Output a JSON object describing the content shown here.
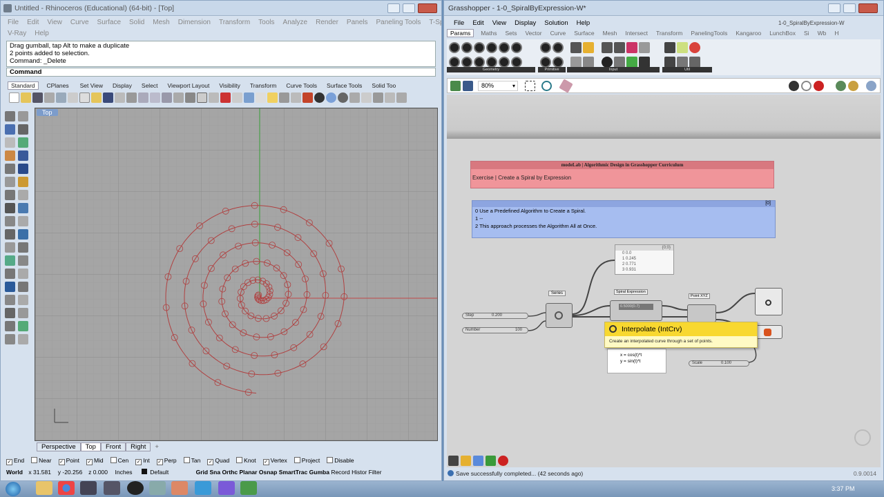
{
  "rhino": {
    "title": "Untitled - Rhinoceros (Educational) (64-bit) - [Top]",
    "menu": [
      "File",
      "Edit",
      "View",
      "Curve",
      "Surface",
      "Solid",
      "Mesh",
      "Dimension",
      "Transform",
      "Tools",
      "Analyze",
      "Render",
      "Panels",
      "Paneling Tools",
      "T-Splines"
    ],
    "menu2": [
      "V-Ray",
      "Help"
    ],
    "command_lines": [
      "Drag gumball, tap Alt to make a duplicate",
      "2 points added to selection.",
      "Command: _Delete"
    ],
    "command_label": "Command",
    "tabs": [
      "Standard",
      "CPlanes",
      "Set View",
      "Display",
      "Select",
      "Viewport Layout",
      "Visibility",
      "Transform",
      "Curve Tools",
      "Surface Tools",
      "Solid Too"
    ],
    "viewport_label": "Top",
    "view_tabs": [
      "Perspective",
      "Top",
      "Front",
      "Right"
    ],
    "add_tab": "+",
    "osnaps": [
      "End",
      "Near",
      "Point",
      "Mid",
      "Cen",
      "Int",
      "Perp",
      "Tan",
      "Quad",
      "Knot",
      "Vertex",
      "Project",
      "Disable"
    ],
    "osnap_checked": [
      true,
      false,
      true,
      true,
      false,
      true,
      true,
      false,
      true,
      false,
      true,
      false,
      false
    ],
    "status": {
      "world": "World",
      "x": "x 31.581",
      "y": "y -20.256",
      "z": "z 0.000",
      "units": "Inches",
      "layer": "Default"
    },
    "status_buttons": [
      "Grid Sna",
      "Orthc",
      "Planar",
      "Osnap",
      "SmartTrac",
      "Gumba",
      "Record Histor",
      "Filter"
    ]
  },
  "grasshopper": {
    "title": "Grasshopper - 1-0_SpiralByExpression-W*",
    "title_right": "1-0_SpiralByExpression-W",
    "menu": [
      "File",
      "Edit",
      "View",
      "Display",
      "Solution",
      "Help"
    ],
    "tabs": [
      "Params",
      "Maths",
      "Sets",
      "Vector",
      "Curve",
      "Surface",
      "Mesh",
      "Intersect",
      "Transform",
      "PanelingTools",
      "Kangaroo",
      "LunchBox",
      "Si",
      "Wb",
      "H"
    ],
    "group_labels": [
      "Geometry",
      "Primitive",
      "Input",
      "Util"
    ],
    "zoom": "80%",
    "group1_title": "modeLab | Algorithmic Design in Grasshopper Curriculum",
    "group1_text": "Exercise | Create a Spiral by Expression",
    "group2_lines": [
      "0  Use a Predefined Algorithm to Create a Spiral.",
      "1  --",
      "2  This approach processes the Algorithm All at Once."
    ],
    "group2_badge": "[0]",
    "panel_values": [
      "0  0.0",
      "1  0.245",
      "2  0.771",
      "3  0.931"
    ],
    "panel_header": "{0;0}",
    "node_series": "Series",
    "node_spiral": "Spiral Expression",
    "node_point": "Point XYZ",
    "node_expression_lines": [
      "x = cos(t)*t",
      "y = sin(t)*t"
    ],
    "slider_step": "Step",
    "slider_step_value": "0.200",
    "slider_number": "Number",
    "slider_number_value": "100",
    "slider_scale": "Scale",
    "slider_scale_value": "0.100",
    "spiral_inner": "0.5000{0.7}",
    "tooltip_title": "Interpolate (IntCrv)",
    "tooltip_text": "Create an interpolated curve through a set of points.",
    "status": "Save successfully completed... (42 seconds ago)",
    "version": "0.9.0014"
  },
  "taskbar": {
    "time": "3:37 PM"
  }
}
